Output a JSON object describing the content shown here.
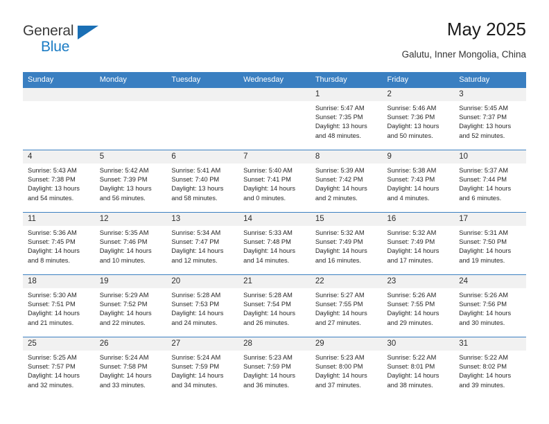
{
  "logo": {
    "word_top": "General",
    "word_bottom": "Blue",
    "triangle_color": "#1a6fb5",
    "blue_color": "#1a7bc4"
  },
  "header": {
    "title": "May 2025",
    "subtitle": "Galutu, Inner Mongolia, China",
    "accent_color": "#3a7fc1"
  },
  "calendar": {
    "weekdays": [
      "Sunday",
      "Monday",
      "Tuesday",
      "Wednesday",
      "Thursday",
      "Friday",
      "Saturday"
    ],
    "labels": {
      "sunrise": "Sunrise:",
      "sunset": "Sunset:",
      "daylight": "Daylight:"
    },
    "weeks": [
      [
        {
          "day": "",
          "empty": true
        },
        {
          "day": "",
          "empty": true
        },
        {
          "day": "",
          "empty": true
        },
        {
          "day": "",
          "empty": true
        },
        {
          "day": "1",
          "sunrise": "Sunrise: 5:47 AM",
          "sunset": "Sunset: 7:35 PM",
          "daylight1": "Daylight: 13 hours",
          "daylight2": "and 48 minutes."
        },
        {
          "day": "2",
          "sunrise": "Sunrise: 5:46 AM",
          "sunset": "Sunset: 7:36 PM",
          "daylight1": "Daylight: 13 hours",
          "daylight2": "and 50 minutes."
        },
        {
          "day": "3",
          "sunrise": "Sunrise: 5:45 AM",
          "sunset": "Sunset: 7:37 PM",
          "daylight1": "Daylight: 13 hours",
          "daylight2": "and 52 minutes."
        }
      ],
      [
        {
          "day": "4",
          "sunrise": "Sunrise: 5:43 AM",
          "sunset": "Sunset: 7:38 PM",
          "daylight1": "Daylight: 13 hours",
          "daylight2": "and 54 minutes."
        },
        {
          "day": "5",
          "sunrise": "Sunrise: 5:42 AM",
          "sunset": "Sunset: 7:39 PM",
          "daylight1": "Daylight: 13 hours",
          "daylight2": "and 56 minutes."
        },
        {
          "day": "6",
          "sunrise": "Sunrise: 5:41 AM",
          "sunset": "Sunset: 7:40 PM",
          "daylight1": "Daylight: 13 hours",
          "daylight2": "and 58 minutes."
        },
        {
          "day": "7",
          "sunrise": "Sunrise: 5:40 AM",
          "sunset": "Sunset: 7:41 PM",
          "daylight1": "Daylight: 14 hours",
          "daylight2": "and 0 minutes."
        },
        {
          "day": "8",
          "sunrise": "Sunrise: 5:39 AM",
          "sunset": "Sunset: 7:42 PM",
          "daylight1": "Daylight: 14 hours",
          "daylight2": "and 2 minutes."
        },
        {
          "day": "9",
          "sunrise": "Sunrise: 5:38 AM",
          "sunset": "Sunset: 7:43 PM",
          "daylight1": "Daylight: 14 hours",
          "daylight2": "and 4 minutes."
        },
        {
          "day": "10",
          "sunrise": "Sunrise: 5:37 AM",
          "sunset": "Sunset: 7:44 PM",
          "daylight1": "Daylight: 14 hours",
          "daylight2": "and 6 minutes."
        }
      ],
      [
        {
          "day": "11",
          "sunrise": "Sunrise: 5:36 AM",
          "sunset": "Sunset: 7:45 PM",
          "daylight1": "Daylight: 14 hours",
          "daylight2": "and 8 minutes."
        },
        {
          "day": "12",
          "sunrise": "Sunrise: 5:35 AM",
          "sunset": "Sunset: 7:46 PM",
          "daylight1": "Daylight: 14 hours",
          "daylight2": "and 10 minutes."
        },
        {
          "day": "13",
          "sunrise": "Sunrise: 5:34 AM",
          "sunset": "Sunset: 7:47 PM",
          "daylight1": "Daylight: 14 hours",
          "daylight2": "and 12 minutes."
        },
        {
          "day": "14",
          "sunrise": "Sunrise: 5:33 AM",
          "sunset": "Sunset: 7:48 PM",
          "daylight1": "Daylight: 14 hours",
          "daylight2": "and 14 minutes."
        },
        {
          "day": "15",
          "sunrise": "Sunrise: 5:32 AM",
          "sunset": "Sunset: 7:49 PM",
          "daylight1": "Daylight: 14 hours",
          "daylight2": "and 16 minutes."
        },
        {
          "day": "16",
          "sunrise": "Sunrise: 5:32 AM",
          "sunset": "Sunset: 7:49 PM",
          "daylight1": "Daylight: 14 hours",
          "daylight2": "and 17 minutes."
        },
        {
          "day": "17",
          "sunrise": "Sunrise: 5:31 AM",
          "sunset": "Sunset: 7:50 PM",
          "daylight1": "Daylight: 14 hours",
          "daylight2": "and 19 minutes."
        }
      ],
      [
        {
          "day": "18",
          "sunrise": "Sunrise: 5:30 AM",
          "sunset": "Sunset: 7:51 PM",
          "daylight1": "Daylight: 14 hours",
          "daylight2": "and 21 minutes."
        },
        {
          "day": "19",
          "sunrise": "Sunrise: 5:29 AM",
          "sunset": "Sunset: 7:52 PM",
          "daylight1": "Daylight: 14 hours",
          "daylight2": "and 22 minutes."
        },
        {
          "day": "20",
          "sunrise": "Sunrise: 5:28 AM",
          "sunset": "Sunset: 7:53 PM",
          "daylight1": "Daylight: 14 hours",
          "daylight2": "and 24 minutes."
        },
        {
          "day": "21",
          "sunrise": "Sunrise: 5:28 AM",
          "sunset": "Sunset: 7:54 PM",
          "daylight1": "Daylight: 14 hours",
          "daylight2": "and 26 minutes."
        },
        {
          "day": "22",
          "sunrise": "Sunrise: 5:27 AM",
          "sunset": "Sunset: 7:55 PM",
          "daylight1": "Daylight: 14 hours",
          "daylight2": "and 27 minutes."
        },
        {
          "day": "23",
          "sunrise": "Sunrise: 5:26 AM",
          "sunset": "Sunset: 7:55 PM",
          "daylight1": "Daylight: 14 hours",
          "daylight2": "and 29 minutes."
        },
        {
          "day": "24",
          "sunrise": "Sunrise: 5:26 AM",
          "sunset": "Sunset: 7:56 PM",
          "daylight1": "Daylight: 14 hours",
          "daylight2": "and 30 minutes."
        }
      ],
      [
        {
          "day": "25",
          "sunrise": "Sunrise: 5:25 AM",
          "sunset": "Sunset: 7:57 PM",
          "daylight1": "Daylight: 14 hours",
          "daylight2": "and 32 minutes."
        },
        {
          "day": "26",
          "sunrise": "Sunrise: 5:24 AM",
          "sunset": "Sunset: 7:58 PM",
          "daylight1": "Daylight: 14 hours",
          "daylight2": "and 33 minutes."
        },
        {
          "day": "27",
          "sunrise": "Sunrise: 5:24 AM",
          "sunset": "Sunset: 7:59 PM",
          "daylight1": "Daylight: 14 hours",
          "daylight2": "and 34 minutes."
        },
        {
          "day": "28",
          "sunrise": "Sunrise: 5:23 AM",
          "sunset": "Sunset: 7:59 PM",
          "daylight1": "Daylight: 14 hours",
          "daylight2": "and 36 minutes."
        },
        {
          "day": "29",
          "sunrise": "Sunrise: 5:23 AM",
          "sunset": "Sunset: 8:00 PM",
          "daylight1": "Daylight: 14 hours",
          "daylight2": "and 37 minutes."
        },
        {
          "day": "30",
          "sunrise": "Sunrise: 5:22 AM",
          "sunset": "Sunset: 8:01 PM",
          "daylight1": "Daylight: 14 hours",
          "daylight2": "and 38 minutes."
        },
        {
          "day": "31",
          "sunrise": "Sunrise: 5:22 AM",
          "sunset": "Sunset: 8:02 PM",
          "daylight1": "Daylight: 14 hours",
          "daylight2": "and 39 minutes."
        }
      ]
    ]
  }
}
